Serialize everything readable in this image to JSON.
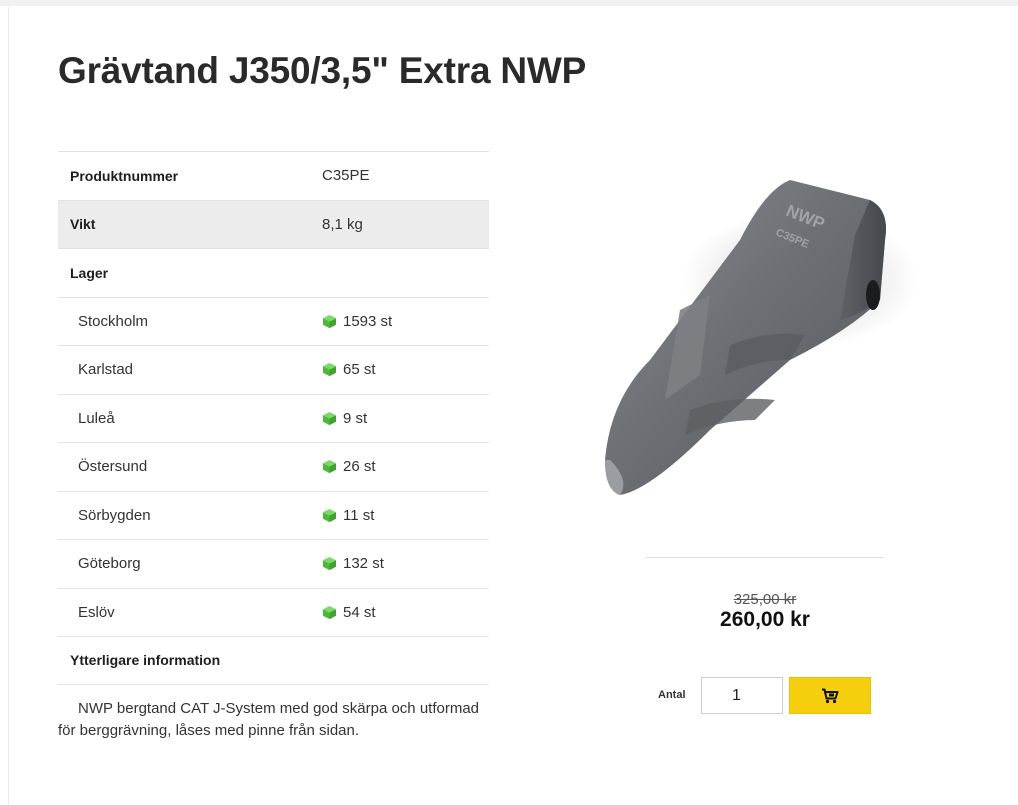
{
  "product": {
    "title": "Grävtand J350/3,5\" Extra NWP",
    "specs": [
      {
        "label": "Produktnummer",
        "value": "C35PE"
      },
      {
        "label": "Vikt",
        "value": "8,1 kg"
      },
      {
        "label": "Lager",
        "value": ""
      }
    ],
    "stock": [
      {
        "location": "Stockholm",
        "qty": "1593 st"
      },
      {
        "location": "Karlstad",
        "qty": "65 st"
      },
      {
        "location": "Luleå",
        "qty": "9 st"
      },
      {
        "location": "Östersund",
        "qty": "26 st"
      },
      {
        "location": "Sörbygden",
        "qty": "11 st"
      },
      {
        "location": "Göteborg",
        "qty": "132 st"
      },
      {
        "location": "Eslöv",
        "qty": "54 st"
      }
    ],
    "more_info_label": "Ytterligare information",
    "description": "NWP bergtand CAT J-System med god skärpa och utformad för berggrävning, låses med pinne från sidan.",
    "image_marking": "NWP C35PE"
  },
  "pricing": {
    "old_price": "325,00 kr",
    "price": "260,00 kr"
  },
  "purchase": {
    "qty_label": "Antal",
    "qty_value": "1",
    "cart_icon": "cart-icon"
  },
  "colors": {
    "accent": "#f5cf0d",
    "stock_icon": "#5cc94a"
  }
}
